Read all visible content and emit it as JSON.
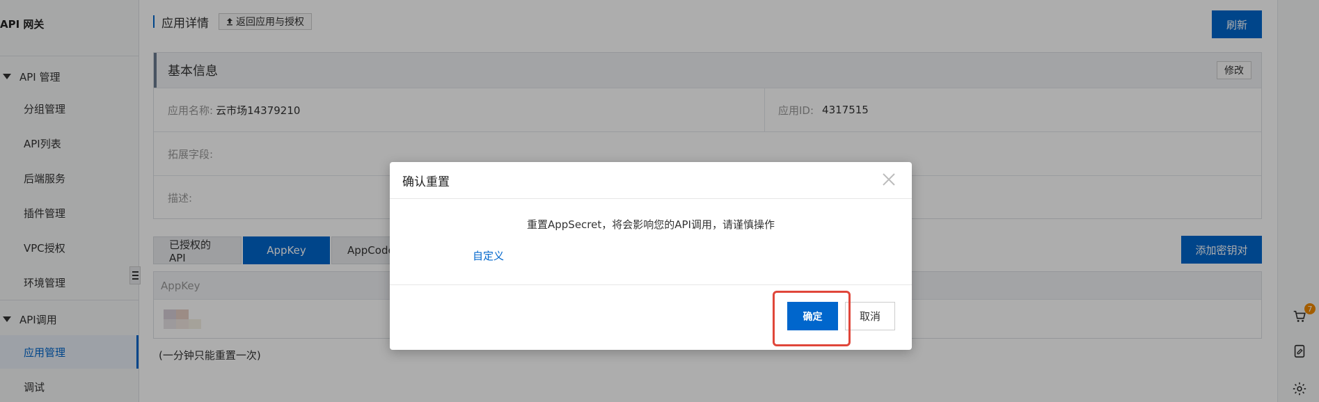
{
  "sidebar": {
    "title": "API 网关",
    "groups": [
      {
        "label": "API 管理"
      },
      {
        "label": "API调用"
      }
    ],
    "items": [
      {
        "label": "分组管理"
      },
      {
        "label": "API列表"
      },
      {
        "label": "后端服务"
      },
      {
        "label": "插件管理"
      },
      {
        "label": "VPC授权"
      },
      {
        "label": "环境管理"
      },
      {
        "label": "应用管理"
      },
      {
        "label": "调试"
      }
    ]
  },
  "header": {
    "title": "应用详情",
    "back_label": "返回应用与授权",
    "refresh_label": "刷新"
  },
  "basic_info": {
    "title": "基本信息",
    "edit_label": "修改",
    "app_name_label": "应用名称:",
    "app_name_value": "云市场14379210",
    "app_id_label": "应用ID:",
    "app_id_value": "4317515",
    "ext_label": "拓展字段:",
    "desc_label": "描述:"
  },
  "tabs": [
    {
      "label": "已授权的API"
    },
    {
      "label": "AppKey"
    },
    {
      "label": "AppCode"
    }
  ],
  "add_key_label": "添加密钥对",
  "key_table": {
    "header": "AppKey"
  },
  "hint": "(一分钟只能重置一次)",
  "cart_badge": "7",
  "modal": {
    "title": "确认重置",
    "message": "重置AppSecret，将会影响您的API调用，请谨慎操作",
    "link": "自定义",
    "ok_label": "确定",
    "cancel_label": "取消"
  },
  "colors": {
    "primary": "#0066cc",
    "highlight": "#e0463a",
    "badge": "#f08a00"
  }
}
